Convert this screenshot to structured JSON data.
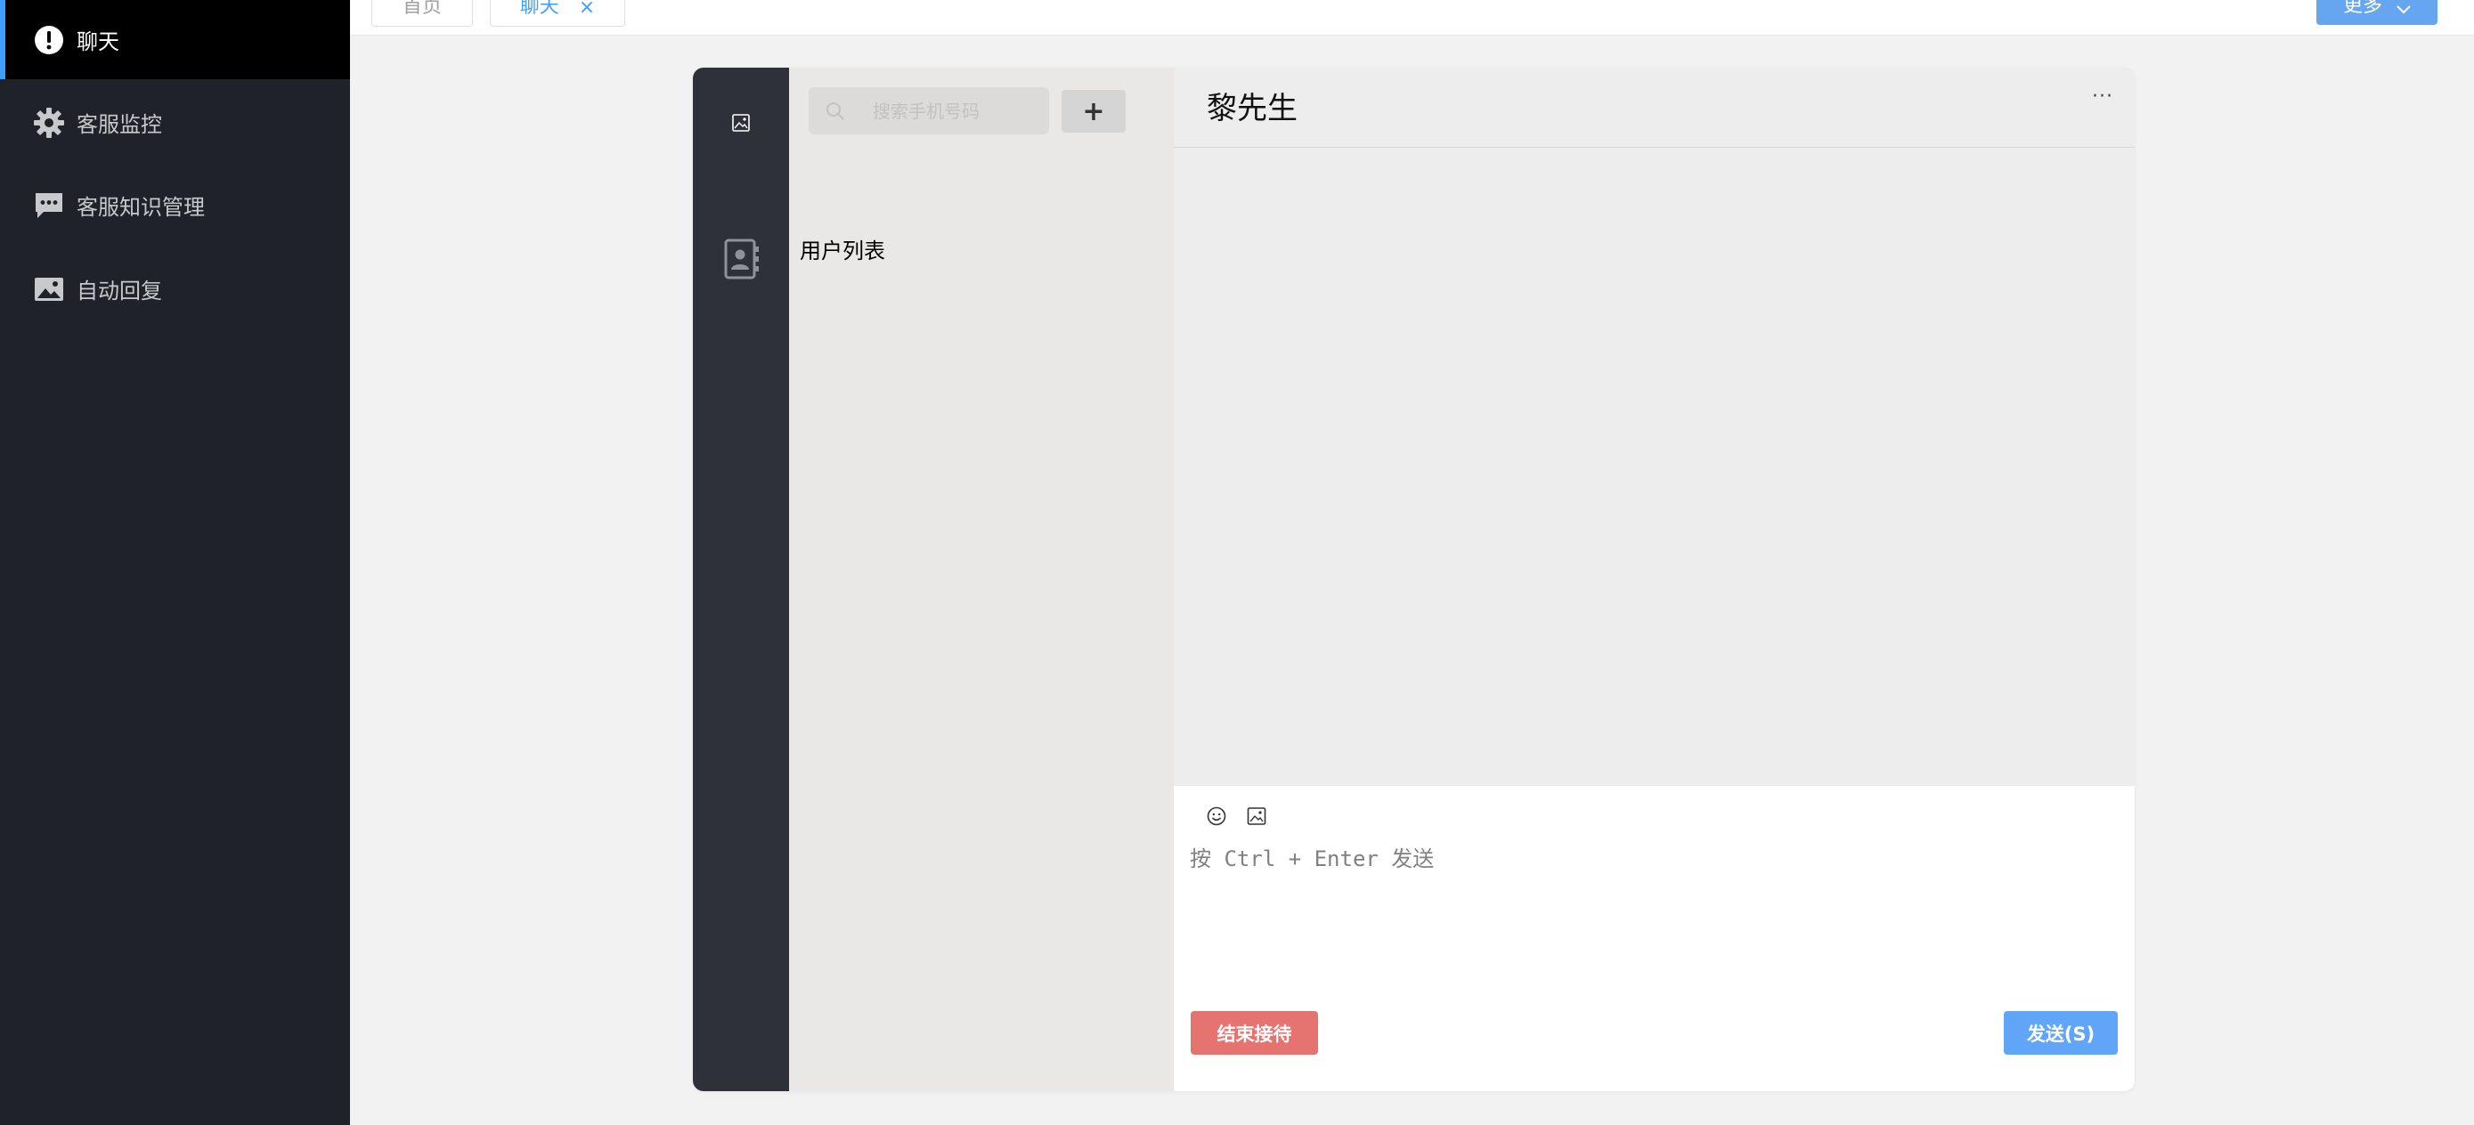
{
  "sidebar": {
    "items": [
      {
        "label": "聊天",
        "icon": "alert-circle-icon",
        "active": true
      },
      {
        "label": "客服监控",
        "icon": "gear-icon",
        "active": false
      },
      {
        "label": "客服知识管理",
        "icon": "chat-bubble-icon",
        "active": false
      },
      {
        "label": "自动回复",
        "icon": "image-icon",
        "active": false
      }
    ]
  },
  "tabs": {
    "home_label": "首页",
    "chat_label": "聊天",
    "close_glyph": "×",
    "more_label": "更多"
  },
  "chat": {
    "search_placeholder": "搜索手机号码",
    "add_label": "+",
    "user_list_title": "用户列表",
    "contact_name": "黎先生",
    "more_glyph": "···",
    "input_placeholder": "按 Ctrl + Enter 发送",
    "end_button": "结束接待",
    "send_button": "发送(S)"
  },
  "colors": {
    "sidebar_bg": "#1f2229",
    "active_accent": "#409eff",
    "end_button": "#e57471",
    "send_button": "#60a5f7"
  }
}
